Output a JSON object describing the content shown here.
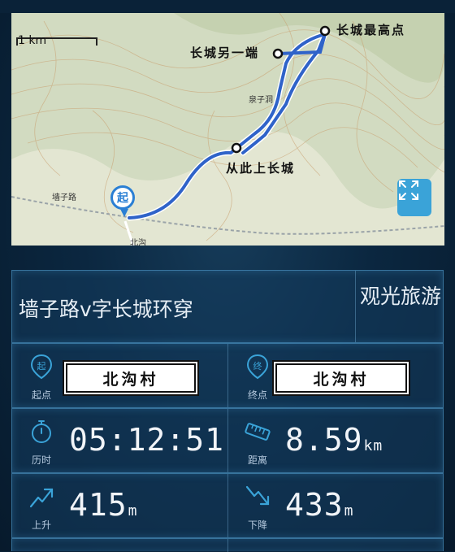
{
  "map": {
    "scale_label": "1 km",
    "waypoints": {
      "highest": "长城最高点",
      "other_end": "长城另一端",
      "ascend": "从此上长城"
    },
    "road_label": "墙子路",
    "spring_label": "泉子洞",
    "village_label": "北沟",
    "start_marker": "起"
  },
  "route": {
    "title": "墙子路v字长城环穿",
    "category": "观光旅游"
  },
  "endpoints": {
    "start": {
      "label": "起点",
      "icon_char": "起",
      "value": "北沟村"
    },
    "end": {
      "label": "终点",
      "icon_char": "终",
      "value": "北沟村"
    }
  },
  "stats": {
    "duration": {
      "label": "历时",
      "value": "05:12:51"
    },
    "distance": {
      "label": "距离",
      "value": "8.59",
      "unit": "km"
    },
    "ascent": {
      "label": "上升",
      "value": "415",
      "unit": "m"
    },
    "descent": {
      "label": "下降",
      "value": "433",
      "unit": "m"
    }
  },
  "colors": {
    "accent": "#3aa3d8",
    "route_line": "#2f63c9",
    "panel_bg": "#0b2740"
  }
}
